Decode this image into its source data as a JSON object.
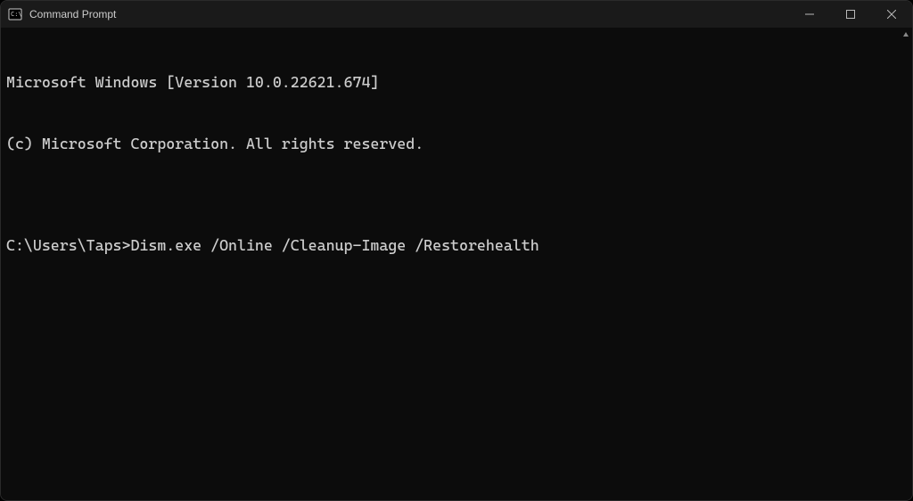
{
  "window": {
    "title": "Command Prompt"
  },
  "terminal": {
    "line1": "Microsoft Windows [Version 10.0.22621.674]",
    "line2": "(c) Microsoft Corporation. All rights reserved.",
    "blank": "",
    "prompt": "C:\\Users\\Taps>",
    "command": "Dism.exe /Online /Cleanup-Image /Restorehealth"
  }
}
